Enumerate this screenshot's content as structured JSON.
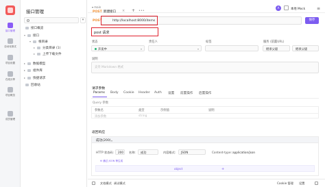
{
  "rail": {
    "items": [
      {
        "label": "接口管理",
        "icon": "api-icon",
        "active": true
      },
      {
        "label": "自动化测试",
        "icon": "test-icon",
        "active": false
      },
      {
        "label": "项目设置",
        "icon": "settings-icon",
        "active": false
      },
      {
        "label": "在线分享",
        "icon": "share-icon",
        "active": false
      },
      {
        "label": "项目概览",
        "icon": "overview-icon",
        "active": false
      },
      {
        "label": "成员管理",
        "icon": "members-icon",
        "active": false
      }
    ]
  },
  "sidebar": {
    "title": "接口管理",
    "tree": [
      {
        "label": "接口概览"
      },
      {
        "label": "接口"
      },
      {
        "label": "根目录"
      },
      {
        "label": "分类目录 (1)"
      },
      {
        "label": "上传下载文件"
      },
      {
        "label": "数据模型"
      },
      {
        "label": "组件库"
      },
      {
        "label": "快捷请求"
      },
      {
        "label": "回收站"
      }
    ]
  },
  "tabs": {
    "env": "▾ main",
    "active_tab": {
      "method": "POST",
      "name": "新建接口"
    },
    "close": "×",
    "add": "+",
    "more": "•••",
    "avatar": "A",
    "env_selector": "本地 Mock",
    "menu": "≡"
  },
  "request": {
    "method": "POST",
    "url": "http://localhost:8000/items",
    "save_label": "保存",
    "name": "post 请求"
  },
  "fields": {
    "status_label": "状态",
    "status_value": "开发中",
    "owner_label": "责任人",
    "tags_label": "标签",
    "service_label": "服务 (前置URL)",
    "service_value": "继承父级",
    "service_value2": "继承父级",
    "description_label": "说明",
    "description_placeholder": "支持 Markdown 格式"
  },
  "params": {
    "title": "请求参数",
    "tabs": [
      "Params",
      "Body",
      "Cookie",
      "Header",
      "Auth",
      "设置",
      "前置操作",
      "后置操作"
    ],
    "query_title": "Query 参数",
    "headers": [
      "参数名",
      "类型",
      "示例值",
      "说明"
    ],
    "placeholders": [
      "添加参数",
      "string"
    ]
  },
  "response": {
    "section_title": "返回响应",
    "tab_label": "成功(200)",
    "http_status_label": "HTTP 状态码:",
    "http_status_value": "200",
    "name_label": "名称:",
    "name_value": "成功",
    "format_label": "内容格式:",
    "format_value": "JSON",
    "content_type_label": "Content-type:",
    "content_type_value": "application/json",
    "schema_link": "⊕ 通过 JSON 等生成",
    "json_type": "object",
    "add": "+"
  },
  "bottom": {
    "items": [
      "文档模式",
      "调试模式"
    ],
    "cookie_label": "Cookie 管理",
    "settings_label": "设置"
  }
}
